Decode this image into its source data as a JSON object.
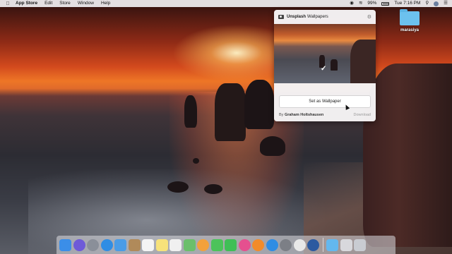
{
  "menubar": {
    "app_name": "App Store",
    "items": [
      "Edit",
      "Store",
      "Window",
      "Help"
    ],
    "status": {
      "battery_text": "99%",
      "clock": "Tue 7:16 PM"
    }
  },
  "desktop": {
    "folder_label": "marasiya"
  },
  "popover": {
    "brand": "Unsplash",
    "title": "Wallpapers",
    "set_button_label": "Set as Wallpaper",
    "credit_prefix": "By",
    "credit_name": "Graham Holtshausen",
    "download_label": "Download"
  },
  "dock": {
    "icons": [
      {
        "name": "finder-icon",
        "color": "#3b8ee8"
      },
      {
        "name": "siri-icon",
        "color": "#6e5ad8"
      },
      {
        "name": "launchpad-icon",
        "color": "#8a8f99"
      },
      {
        "name": "safari-icon",
        "color": "#2f8de4"
      },
      {
        "name": "mail-icon",
        "color": "#4a9ce6"
      },
      {
        "name": "contacts-icon",
        "color": "#b08a5a"
      },
      {
        "name": "calendar-icon",
        "color": "#f4f4f4"
      },
      {
        "name": "notes-icon",
        "color": "#f7e27a"
      },
      {
        "name": "reminders-icon",
        "color": "#f0f0f0"
      },
      {
        "name": "maps-icon",
        "color": "#6bbf6b"
      },
      {
        "name": "photos-icon",
        "color": "#f3a13b"
      },
      {
        "name": "messages-icon",
        "color": "#4cc35a"
      },
      {
        "name": "facetime-icon",
        "color": "#3fbf56"
      },
      {
        "name": "itunes-icon",
        "color": "#e5508f"
      },
      {
        "name": "ibooks-icon",
        "color": "#f28b2a"
      },
      {
        "name": "app-store-icon",
        "color": "#2f8de4"
      },
      {
        "name": "system-preferences-icon",
        "color": "#7c7f86"
      },
      {
        "name": "chrome-icon",
        "color": "#e8e8e8"
      },
      {
        "name": "quicktime-icon",
        "color": "#2c5aa0"
      },
      {
        "name": "downloads-folder-icon",
        "color": "#63b8ef"
      },
      {
        "name": "screenshot-icon",
        "color": "#d8d8dc"
      },
      {
        "name": "trash-icon",
        "color": "#c9ccd2"
      }
    ]
  }
}
